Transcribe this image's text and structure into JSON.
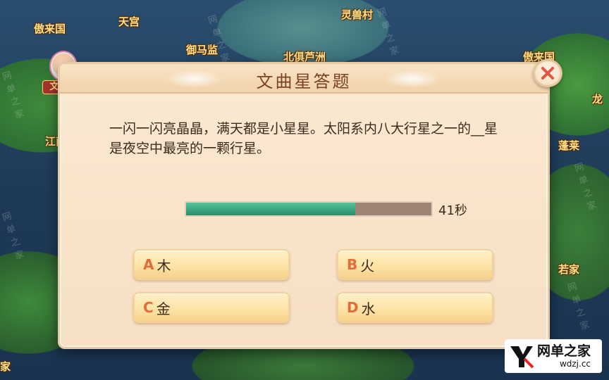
{
  "map": {
    "locations": [
      "傲来国",
      "天宫",
      "灵兽村",
      "御马监",
      "北俱芦洲",
      "傲来国",
      "蓬莱",
      "若家",
      "龙",
      "江南",
      "家"
    ],
    "watermark": "网单之家"
  },
  "npc": {
    "name": "文曲星"
  },
  "dialog": {
    "title": "文曲星答题",
    "question": "一闪一闪亮晶晶，满天都是小星星。太阳系内八大行星之一的__星是夜空中最亮的一颗行星。",
    "timer": {
      "seconds_label": "41秒",
      "progress": 0.69,
      "fill_color": "#3aa27e",
      "track_color": "#9e8474"
    },
    "options": [
      {
        "letter": "A",
        "text": "木"
      },
      {
        "letter": "B",
        "text": "火"
      },
      {
        "letter": "C",
        "text": "金"
      },
      {
        "letter": "D",
        "text": "水"
      }
    ],
    "close_icon": "close-icon",
    "accent_color": "#e36d3a"
  },
  "site_logo": {
    "name": "网单之家",
    "url": "wdzj.cc"
  }
}
